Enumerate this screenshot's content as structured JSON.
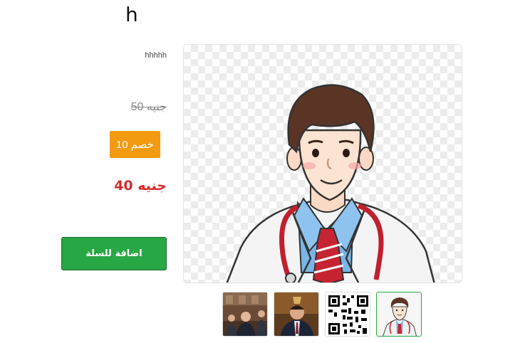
{
  "product": {
    "title": "h",
    "description": "hhhhh",
    "old_price": "50 جنيه",
    "discount": "خصم 10",
    "price": "40 جنيه",
    "add_to_cart": "اضافة للسلة"
  },
  "colors": {
    "discount_bg": "#f39a10",
    "price": "#d62b2b",
    "cart_button": "#28a745"
  },
  "gallery": {
    "main_image": "doctor-cartoon-image",
    "thumbnails": [
      {
        "name": "parliament-photo-thumbnail"
      },
      {
        "name": "man-portrait-thumbnail"
      },
      {
        "name": "qr-code-thumbnail"
      },
      {
        "name": "doctor-cartoon-thumbnail",
        "active": true
      }
    ]
  }
}
